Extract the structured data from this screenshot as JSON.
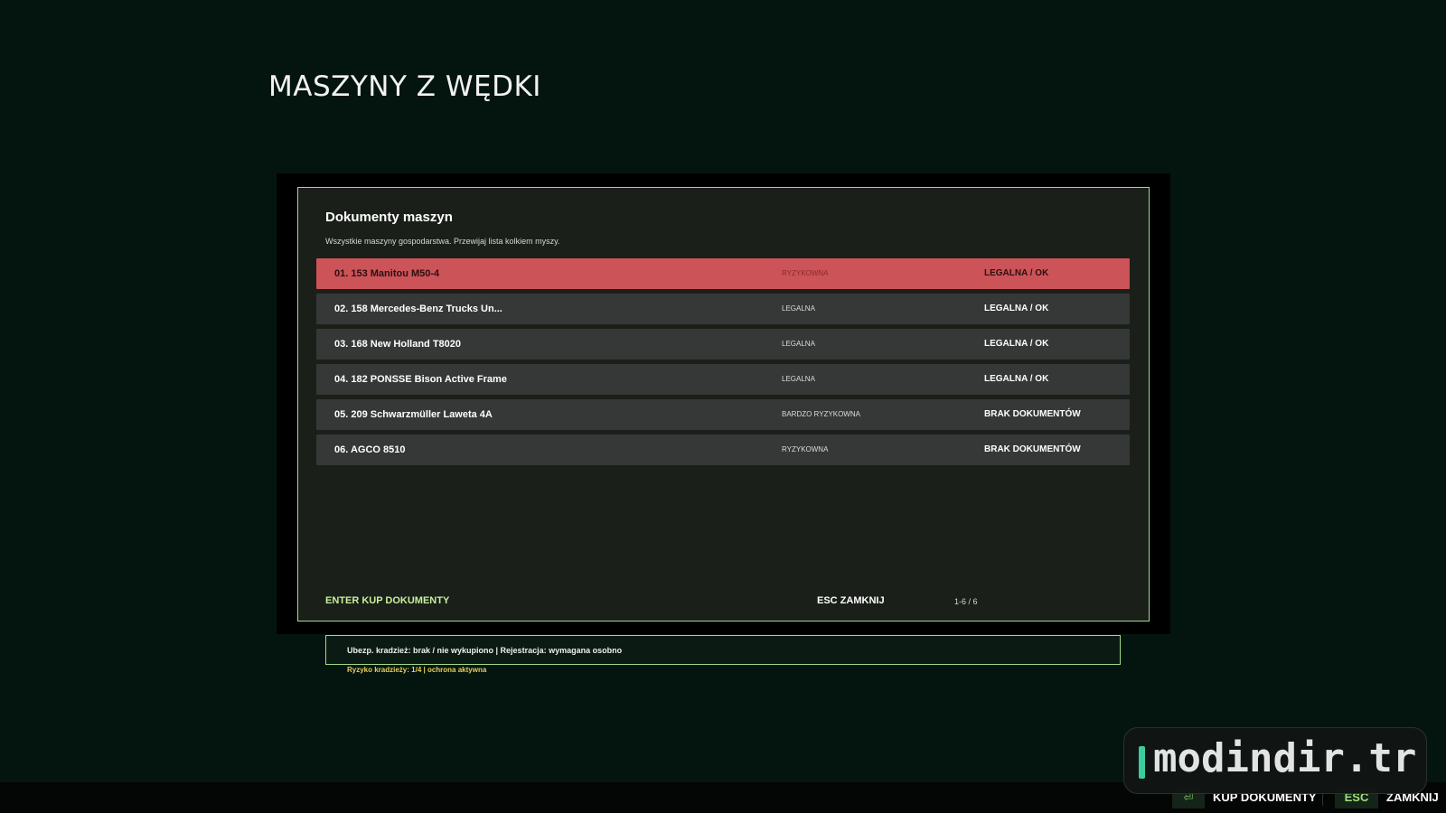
{
  "page_title": "MASZYNY Z WĘDKI",
  "dialog": {
    "title": "Dokumenty maszyn",
    "subtitle": "Wszystkie maszyny gospodarstwa. Przewijaj lista kolkiem myszy.",
    "rows": [
      {
        "name": "01. 153 Manitou M50-4",
        "risk": "RYZYKOWNA",
        "status": "LEGALNA / OK",
        "selected": true
      },
      {
        "name": "02. 158 Mercedes-Benz Trucks Un...",
        "risk": "LEGALNA",
        "status": "LEGALNA / OK",
        "selected": false
      },
      {
        "name": "03. 168 New Holland T8020",
        "risk": "LEGALNA",
        "status": "LEGALNA / OK",
        "selected": false
      },
      {
        "name": "04. 182 PONSSE Bison Active Frame",
        "risk": "LEGALNA",
        "status": "LEGALNA / OK",
        "selected": false
      },
      {
        "name": "05. 209 Schwarzmüller Laweta 4A",
        "risk": "BARDZO RYZYKOWNA",
        "status": "BRAK DOKUMENTÓW",
        "selected": false
      },
      {
        "name": "06. AGCO 8510",
        "risk": "RYZYKOWNA",
        "status": "BRAK DOKUMENTÓW",
        "selected": false
      }
    ],
    "footer": {
      "enter_label": "ENTER KUP DOKUMENTY",
      "esc_label": "ESC ZAMKNIJ",
      "page_counter": "1-6 / 6"
    }
  },
  "info": {
    "line1": "Ubezp. kradzież: brak / nie wykupiono  |  Rejestracja: wymagana osobno",
    "line2": "Ryzyko kradzieży: 1/4  |  ochrona aktywna"
  },
  "bottom_bar": {
    "kup_label": "KUP DOKUMENTY",
    "kup_icon": "enter-key-icon",
    "kup_icon_glyph": "⏎",
    "esc_key": "ESC",
    "zamknij_label": "ZAMKNIJ"
  },
  "watermark": {
    "text": "modindir.tr"
  },
  "colors": {
    "background": "#041510",
    "dialog_bg": "#1a1f19",
    "border_accent": "#9fdc8a",
    "row_bg": "#353837",
    "row_selected": "#cc5357",
    "footer_accent": "#c9ef9f",
    "risk_note": "#e7cf5a"
  }
}
